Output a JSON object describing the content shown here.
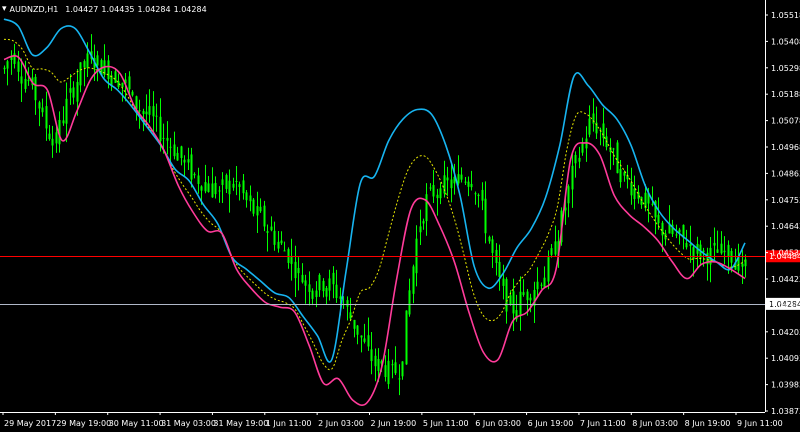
{
  "header": {
    "symbol": "AUDNZD,H1",
    "open": "1.04427",
    "high": "1.04435",
    "low": "1.04284",
    "close": "1.04284"
  },
  "colors": {
    "background": "#000000",
    "candle_up": "#00ff00",
    "upper_band": "#17b4f0",
    "lower_band": "#ff3b9a",
    "middle_line": "#e6e600",
    "price_line": "#ff0000",
    "bid_line": "#b0b8c8",
    "axis_text": "#ffffff"
  },
  "chart_data": {
    "type": "line",
    "symbol": "AUDNZD",
    "timeframe": "H1",
    "y_axis_ticks": [
      "1.05518",
      "1.05408",
      "1.05298",
      "1.05188",
      "1.05078",
      "1.04968",
      "1.04863",
      "1.04753",
      "1.04643",
      "1.04533",
      "1.04423",
      "1.04313",
      "1.04203",
      "1.04093",
      "1.03983",
      "1.03873"
    ],
    "ylim": [
      1.0383,
      1.0556
    ],
    "x_axis_ticks": [
      "29 May 2017",
      "29 May 19:00",
      "30 May 11:00",
      "31 May 03:00",
      "31 May 19:00",
      "1 Jun 11:00",
      "2 Jun 03:00",
      "2 Jun 19:00",
      "5 Jun 11:00",
      "6 Jun 03:00",
      "6 Jun 19:00",
      "7 Jun 11:00",
      "8 Jun 03:00",
      "8 Jun 19:00",
      "9 Jun 11:00"
    ],
    "levels": {
      "current_price_label": "1.04484",
      "current_price": 1.04484,
      "bid_label": "1.04284",
      "bid": 1.04284
    },
    "series": [
      {
        "role": "price",
        "values": [
          1.0527,
          1.0535,
          1.0525,
          1.0521,
          1.0512,
          1.0501,
          1.0497,
          1.051,
          1.0519,
          1.0527,
          1.0532,
          1.0529,
          1.0527,
          1.0524,
          1.0521,
          1.0513,
          1.0509,
          1.0507,
          1.0501,
          1.0497,
          1.0492,
          1.0487,
          1.0482,
          1.048,
          1.0477,
          1.0476,
          1.0478,
          1.0479,
          1.0472,
          1.0467,
          1.0463,
          1.0458,
          1.0453,
          1.0449,
          1.0442,
          1.0437,
          1.0436,
          1.0437,
          1.0436,
          1.0431,
          1.0424,
          1.0417,
          1.0409,
          1.0403,
          1.0402,
          1.0399,
          1.0402,
          1.0433,
          1.046,
          1.0472,
          1.0476,
          1.0478,
          1.0479,
          1.0481,
          1.0483,
          1.0475,
          1.0459,
          1.0443,
          1.0431,
          1.0426,
          1.0431,
          1.0434,
          1.0438,
          1.0443,
          1.0454,
          1.0468,
          1.0484,
          1.0494,
          1.0505,
          1.0502,
          1.0496,
          1.0487,
          1.0481,
          1.0477,
          1.0473,
          1.0467,
          1.046,
          1.0459,
          1.0456,
          1.0455,
          1.0451,
          1.045,
          1.0449,
          1.045,
          1.0449,
          1.0447,
          1.0444
        ]
      },
      {
        "role": "upper",
        "values": [
          1.0548,
          1.0545,
          1.0533,
          1.0536,
          1.0544,
          1.0544,
          1.0534,
          1.0523,
          1.0518,
          1.0511,
          1.0503,
          1.0495,
          1.0485,
          1.048,
          1.047,
          1.0462,
          1.0448,
          1.0443,
          1.0438,
          1.0433,
          1.0431,
          1.0423,
          1.0415,
          1.0405,
          1.0442,
          1.0479,
          1.0482,
          1.0497,
          1.0506,
          1.051,
          1.0508,
          1.0495,
          1.0474,
          1.0444,
          1.0435,
          1.0441,
          1.0452,
          1.046,
          1.0473,
          1.0495,
          1.0524,
          1.052,
          1.0512,
          1.0506,
          1.0495,
          1.0478,
          1.0467,
          1.046,
          1.0455,
          1.045,
          1.0446,
          1.0443,
          1.0454
        ]
      },
      {
        "role": "lower",
        "values": [
          1.0531,
          1.0532,
          1.0521,
          1.0518,
          1.0497,
          1.0509,
          1.0523,
          1.0528,
          1.0525,
          1.0511,
          1.0503,
          1.0493,
          1.0478,
          1.0467,
          1.0459,
          1.0458,
          1.0443,
          1.0435,
          1.0429,
          1.0427,
          1.0425,
          1.0411,
          1.0395,
          1.0397,
          1.0388,
          1.0387,
          1.0402,
          1.0438,
          1.0468,
          1.0472,
          1.0461,
          1.0446,
          1.0425,
          1.0408,
          1.0405,
          1.0421,
          1.0425,
          1.0434,
          1.0443,
          1.0489,
          1.0496,
          1.0491,
          1.0474,
          1.0466,
          1.0461,
          1.0455,
          1.0446,
          1.0439,
          1.0445,
          1.0446,
          1.0443,
          1.0439
        ]
      }
    ]
  }
}
